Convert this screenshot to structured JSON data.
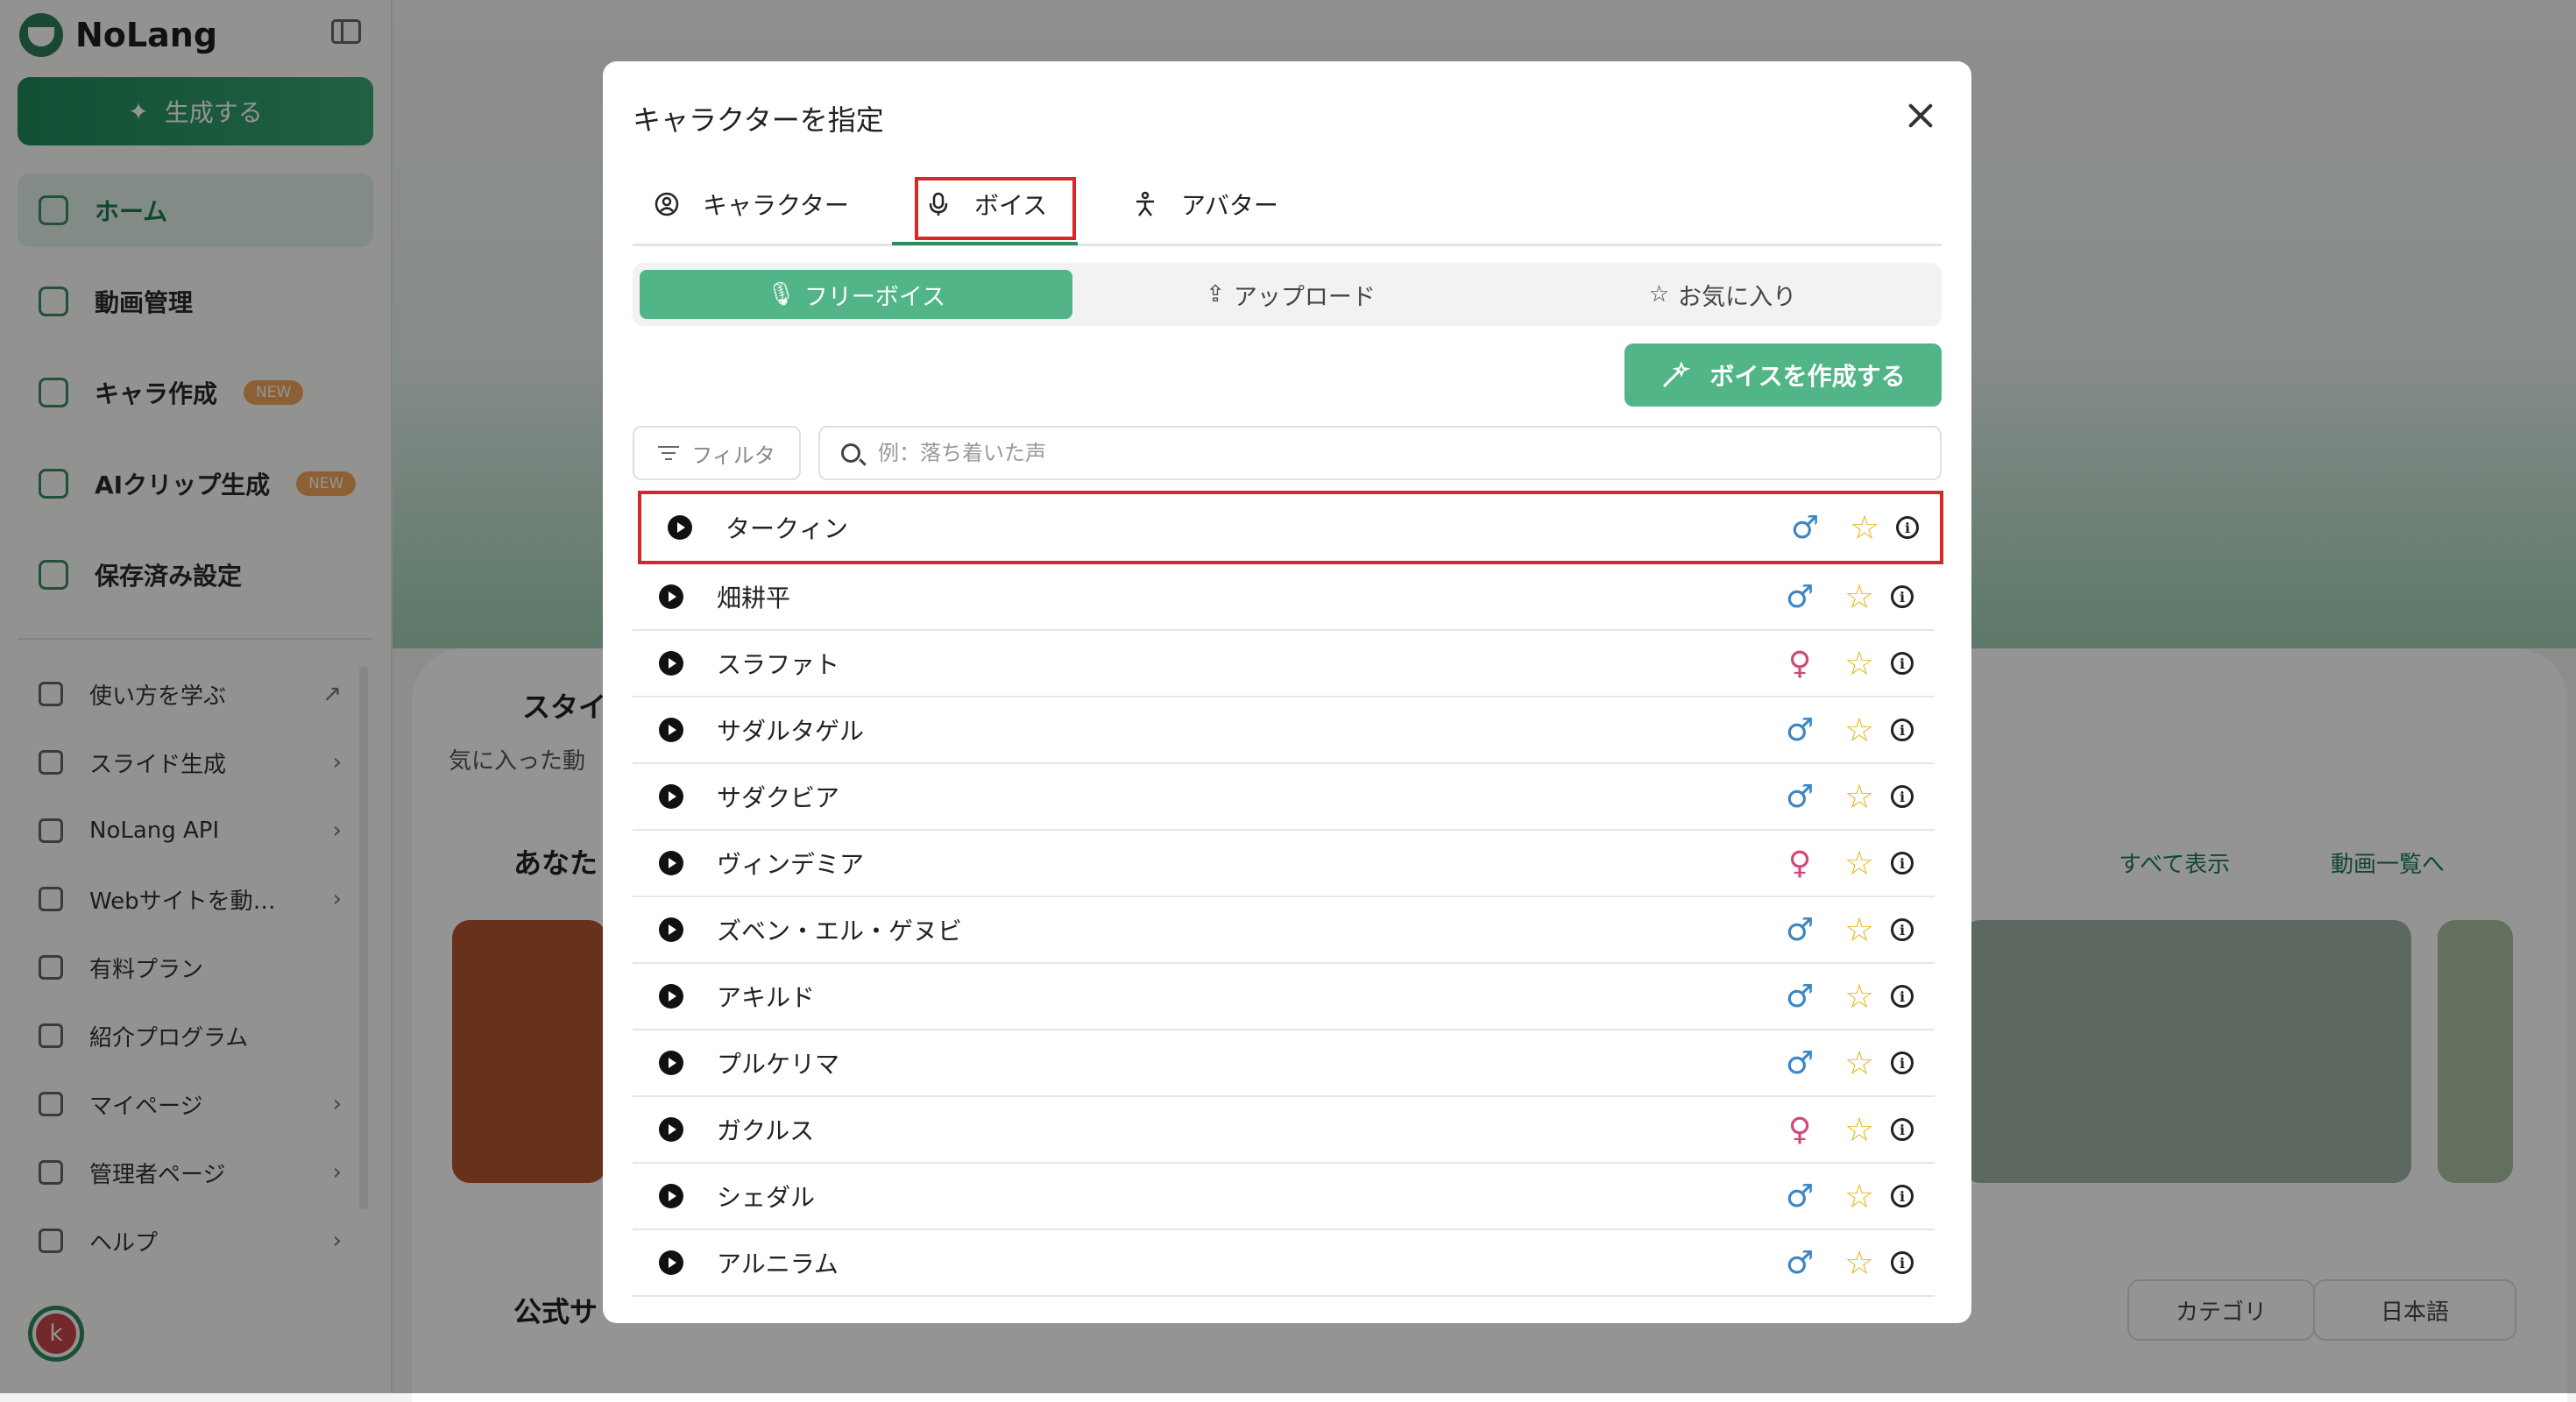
{
  "app": {
    "name": "NoLang",
    "generate_label": "生成する",
    "nav": [
      {
        "label": "ホーム",
        "active": true
      },
      {
        "label": "動画管理"
      },
      {
        "label": "キャラ作成",
        "badge": "NEW"
      },
      {
        "label": "AIクリップ生成",
        "badge": "NEW"
      },
      {
        "label": "保存済み設定"
      }
    ],
    "sub_nav": [
      {
        "label": "使い方を学ぶ",
        "suffix": "↗"
      },
      {
        "label": "スライド生成",
        "suffix": "›"
      },
      {
        "label": "NoLang API",
        "suffix": "›"
      },
      {
        "label": "Webサイトを動…",
        "suffix": "›"
      },
      {
        "label": "有料プラン",
        "suffix": ""
      },
      {
        "label": "紹介プログラム",
        "suffix": ""
      },
      {
        "label": "マイページ",
        "suffix": "›"
      },
      {
        "label": "管理者ページ",
        "suffix": "›"
      },
      {
        "label": "ヘルプ",
        "suffix": "›"
      }
    ],
    "avatar_initial": "k",
    "bg": {
      "section_style": "スタイ",
      "section_style_sub": "気に入った動",
      "section_yours": "あなた",
      "show_all": "すべて表示",
      "video_list": "動画一覧へ",
      "section_official": "公式サ",
      "category": "カテゴリ",
      "language": "日本語"
    }
  },
  "modal": {
    "title": "キャラクターを指定",
    "tabs": [
      {
        "label": "キャラクター"
      },
      {
        "label": "ボイス",
        "active": true
      },
      {
        "label": "アバター"
      }
    ],
    "segments": [
      {
        "label": "フリーボイス",
        "active": true
      },
      {
        "label": "アップロード"
      },
      {
        "label": "お気に入り"
      }
    ],
    "create_voice_label": "ボイスを作成する",
    "filter_label": "フィルタ",
    "search": {
      "placeholder": "例：落ち着いた声",
      "value": ""
    },
    "voices": [
      {
        "name": "タークィン",
        "gender": "male",
        "selected": true
      },
      {
        "name": "畑耕平",
        "gender": "male"
      },
      {
        "name": "スラファト",
        "gender": "female"
      },
      {
        "name": "サダルタゲル",
        "gender": "male"
      },
      {
        "name": "サダクビア",
        "gender": "male"
      },
      {
        "name": "ヴィンデミア",
        "gender": "female"
      },
      {
        "name": "ズベン・エル・ゲヌビ",
        "gender": "male"
      },
      {
        "name": "アキルド",
        "gender": "male"
      },
      {
        "name": "プルケリマ",
        "gender": "male"
      },
      {
        "name": "ガクルス",
        "gender": "female"
      },
      {
        "name": "シェダル",
        "gender": "male"
      },
      {
        "name": "アルニラム",
        "gender": "male"
      }
    ],
    "colors": {
      "accent": "#52b587",
      "highlight": "#d62828",
      "male": "#3b86c6",
      "female": "#d2467a",
      "star": "#e6b820"
    }
  }
}
